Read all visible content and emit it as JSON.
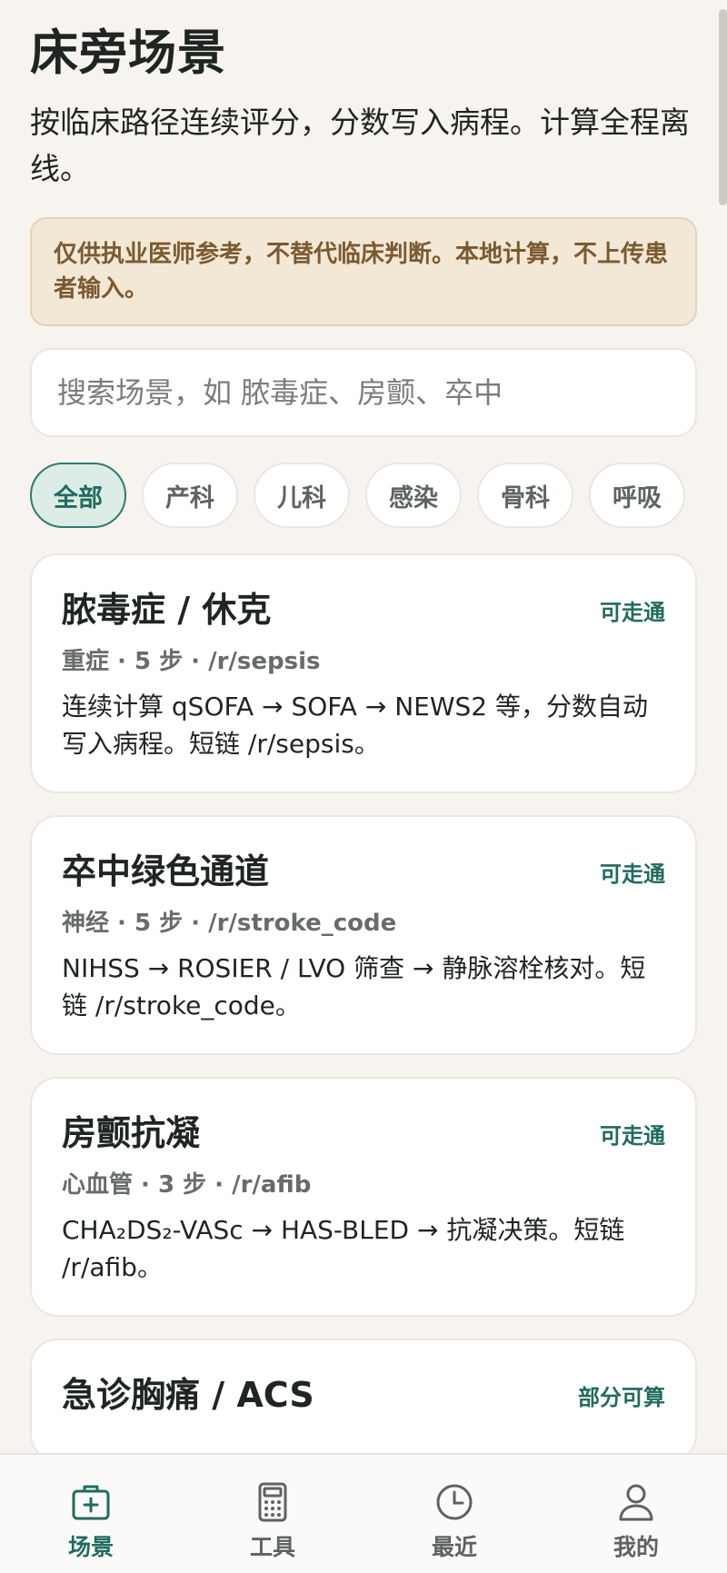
{
  "page": {
    "title": "床旁场景",
    "subtitle": "按临床路径连续评分，分数写入病程。计算全程离线。",
    "notice": "仅供执业医师参考，不替代临床判断。本地计算，不上传患者输入。"
  },
  "search": {
    "placeholder": "搜索场景，如 脓毒症、房颤、卒中",
    "value": ""
  },
  "filters": [
    {
      "label": "全部",
      "active": true
    },
    {
      "label": "产科",
      "active": false
    },
    {
      "label": "儿科",
      "active": false
    },
    {
      "label": "感染",
      "active": false
    },
    {
      "label": "骨科",
      "active": false
    },
    {
      "label": "呼吸",
      "active": false
    }
  ],
  "scenarios": [
    {
      "title": "脓毒症 / 休克",
      "status": "可走通",
      "meta": "重症 · 5 步 · /r/sepsis",
      "description": "连续计算 qSOFA → SOFA → NEWS2 等，分数自动写入病程。短链 /r/sepsis。"
    },
    {
      "title": "卒中绿色通道",
      "status": "可走通",
      "meta": "神经 · 5 步 · /r/stroke_code",
      "description": "NIHSS → ROSIER / LVO 筛查 → 静脉溶栓核对。短链 /r/stroke_code。"
    },
    {
      "title": "房颤抗凝",
      "status": "可走通",
      "meta": "心血管 · 3 步 · /r/afib",
      "description": "CHA₂DS₂-VASc → HAS-BLED → 抗凝决策。短链 /r/afib。"
    },
    {
      "title": "急诊胸痛 / ACS",
      "status": "部分可算",
      "meta": "",
      "description": ""
    }
  ],
  "bottom_nav": [
    {
      "label": "场景",
      "icon": "kit-icon",
      "active": true
    },
    {
      "label": "工具",
      "icon": "calculator-icon",
      "active": false
    },
    {
      "label": "最近",
      "icon": "clock-icon",
      "active": false
    },
    {
      "label": "我的",
      "icon": "user-icon",
      "active": false
    }
  ],
  "colors": {
    "accent": "#216b60",
    "background": "#f7f4f0",
    "notice_bg": "#f3e7d6",
    "notice_text": "#7a5a30"
  }
}
